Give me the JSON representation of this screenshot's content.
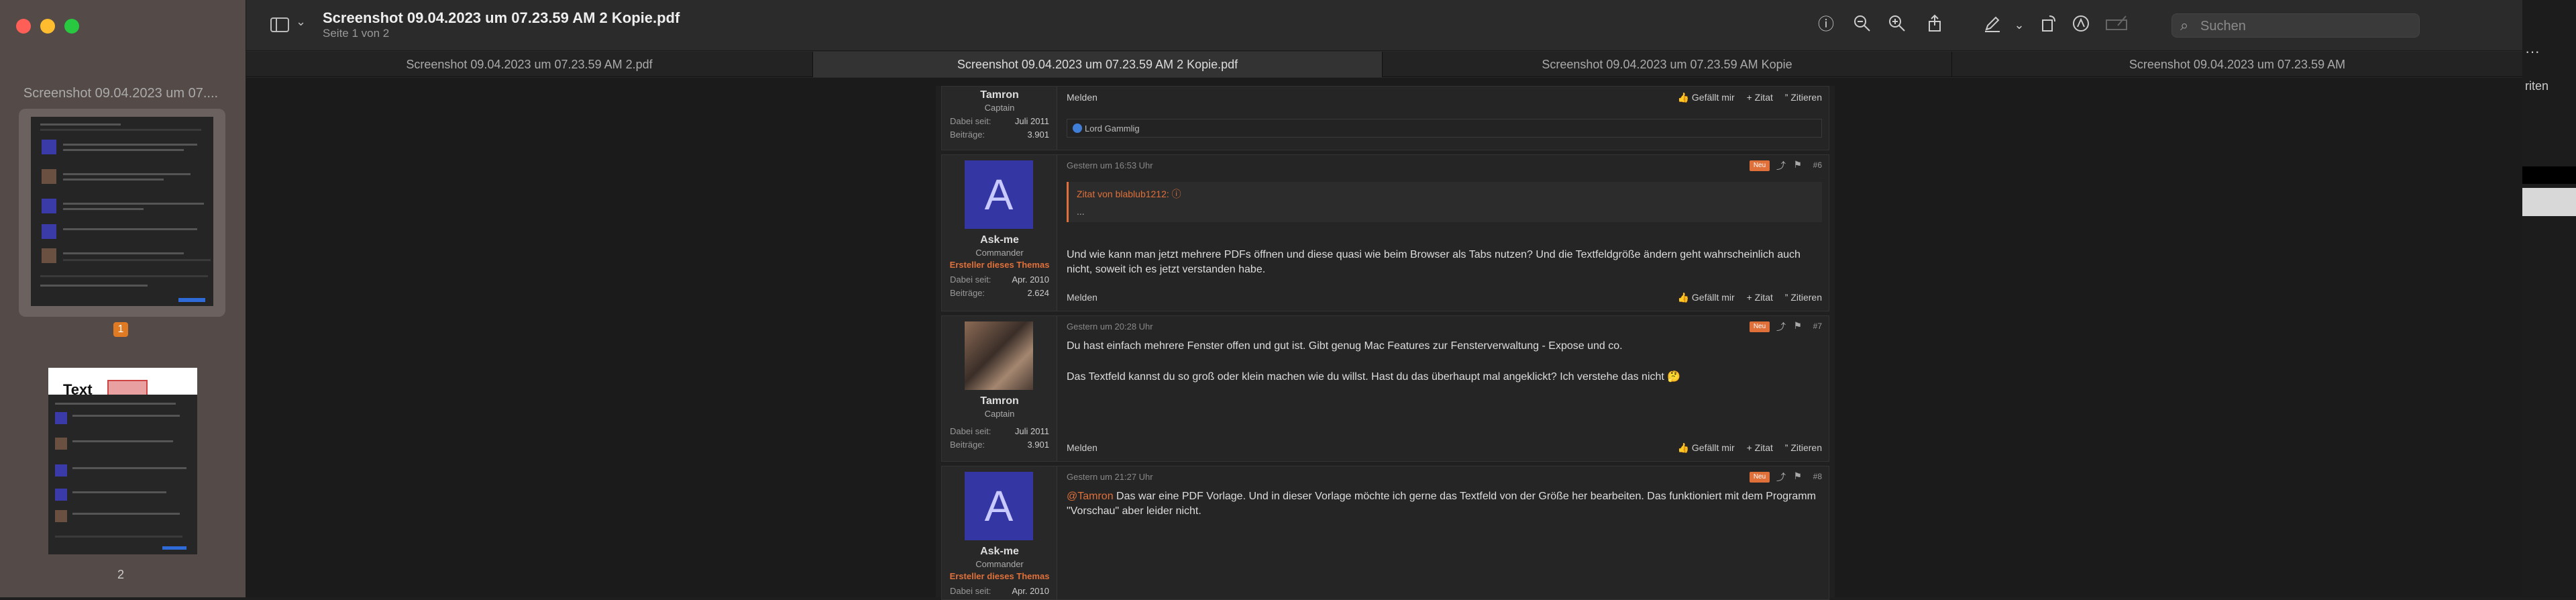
{
  "window": {
    "title": "Screenshot 09.04.2023 um 07.23.59 AM 2 Kopie.pdf",
    "subtitle": "Seite 1 von 2"
  },
  "sidebar": {
    "thumb_title": "Screenshot 09.04.2023 um 07....",
    "page1_label": "1",
    "page2_label": "2",
    "thumb2_text": "Text"
  },
  "toolbar": {
    "search_placeholder": "Suchen"
  },
  "tabs": [
    {
      "label": "Screenshot 09.04.2023 um 07.23.59 AM 2.pdf"
    },
    {
      "label": "Screenshot 09.04.2023 um 07.23.59 AM 2 Kopie.pdf"
    },
    {
      "label": "Screenshot 09.04.2023 um 07.23.59 AM Kopie"
    },
    {
      "label": "Screenshot 09.04.2023 um 07.23.59 AM"
    }
  ],
  "right_edge": {
    "partial_text": "riten",
    "more": "···"
  },
  "footer_actions": {
    "melden": "Melden",
    "like": "👍 Gefällt mir",
    "quote": "+ Zitat",
    "cite": "” Zitieren"
  },
  "posts": [
    {
      "name": "Tamron",
      "rank": "Captain",
      "since_label": "Dabei seit:",
      "since": "Juli 2011",
      "posts_label": "Beiträge:",
      "posts": "3.901",
      "liker": "Lord Gammlig"
    },
    {
      "avatar_letter": "A",
      "name": "Ask-me",
      "rank": "Commander",
      "starter": "Ersteller dieses Themas",
      "since_label": "Dabei seit:",
      "since": "Apr. 2010",
      "posts_label": "Beiträge:",
      "posts": "2.624",
      "time": "Gestern um 16:53 Uhr",
      "new": "Neu",
      "num": "#6",
      "quote_head": "Zitat von blablub1212: ⓘ",
      "quote_body": "...",
      "text": "Und wie kann man jetzt mehrere PDFs öffnen und diese quasi wie beim Browser als Tabs nutzen? Und die Textfeldgröße ändern geht wahrscheinlich auch nicht, soweit ich es jetzt verstanden habe."
    },
    {
      "name": "Tamron",
      "rank": "Captain",
      "since_label": "Dabei seit:",
      "since": "Juli 2011",
      "posts_label": "Beiträge:",
      "posts": "3.901",
      "time": "Gestern um 20:28 Uhr",
      "new": "Neu",
      "num": "#7",
      "text1": "Du hast einfach mehrere Fenster offen und gut ist. Gibt genug Mac Features zur Fensterverwaltung - Expose und co.",
      "text2": "Das Textfeld kannst du so groß oder klein machen wie du willst. Hast du das überhaupt mal angeklickt? Ich verstehe das nicht 🤔"
    },
    {
      "avatar_letter": "A",
      "name": "Ask-me",
      "rank": "Commander",
      "starter": "Ersteller dieses Themas",
      "since_label": "Dabei seit:",
      "since": "Apr. 2010",
      "time": "Gestern um 21:27 Uhr",
      "new": "Neu",
      "num": "#8",
      "mention": "@Tamron",
      "text": " Das war eine PDF Vorlage. Und in dieser Vorlage möchte ich gerne das Textfeld von der Größe her bearbeiten. Das funktioniert mit dem Programm \"Vorschau\" aber leider nicht."
    }
  ]
}
